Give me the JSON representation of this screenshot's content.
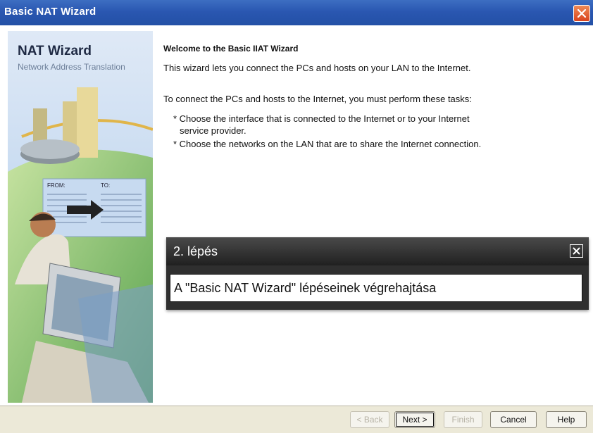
{
  "window": {
    "title": "Basic NAT Wizard"
  },
  "sidebar": {
    "title": "NAT Wizard",
    "subtitle": "Network Address Translation",
    "table_headers": [
      "FROM:",
      "TO:"
    ]
  },
  "main": {
    "welcome": "Welcome to the Basic IIAT Wizard",
    "intro": "This wizard lets you connect the PCs and hosts on your LAN to the Internet.",
    "tasks_intro": "To connect the PCs and hosts to the Internet, you must perform these tasks:",
    "bullet1_line1": "* Choose the interface that is connected to the Internet or to your Internet",
    "bullet1_line2": "service provider.",
    "bullet2": "* Choose the networks on the LAN that are to share the Internet connection."
  },
  "buttons": {
    "back": "< Back",
    "next": "Next >",
    "finish": "Finish",
    "cancel": "Cancel",
    "help": "Help"
  },
  "popup": {
    "title": "2. lépés",
    "body": "A \"Basic NAT Wizard\" lépéseinek végrehajtása"
  },
  "colors": {
    "titlebar": "#2a57b1",
    "close_button": "#d9441f",
    "popup_header": "#202020",
    "sidebar": "#cfe0f4"
  },
  "icons": {
    "close": "close-icon",
    "popup_close": "close-icon"
  }
}
